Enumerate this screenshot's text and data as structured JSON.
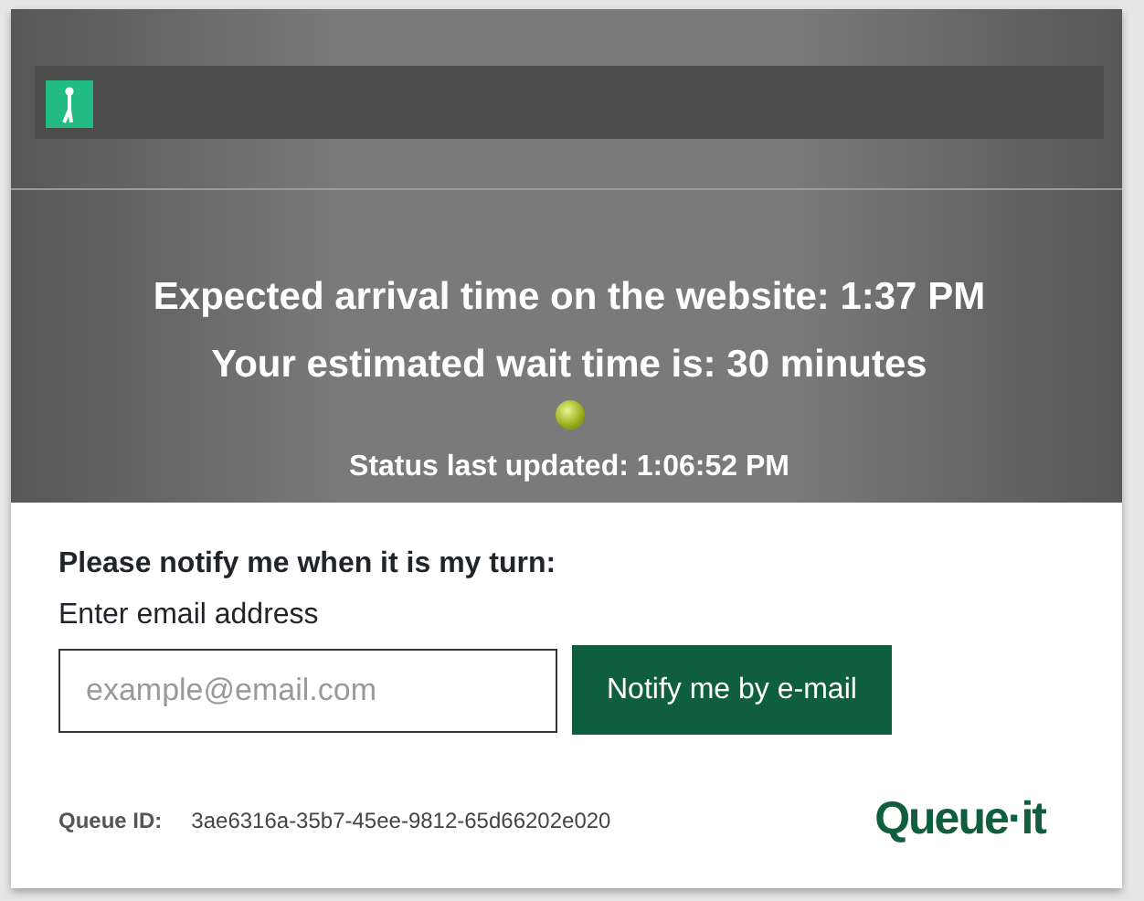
{
  "progress": {
    "level": 0
  },
  "expected_arrival": "Expected arrival time on the website: 1:37 PM",
  "wait_time": "Your estimated wait time is: 30 minutes",
  "status_updated": "Status last updated: 1:06:52 PM",
  "notify": {
    "heading": "Please notify me when it is my turn:",
    "label": "Enter email address",
    "placeholder": "example@email.com",
    "button": "Notify me by e-mail"
  },
  "queue_id": {
    "label": "Queue ID:",
    "value": "3ae6316a-35b7-45ee-9812-65d66202e020"
  },
  "logo": "Queue·it"
}
